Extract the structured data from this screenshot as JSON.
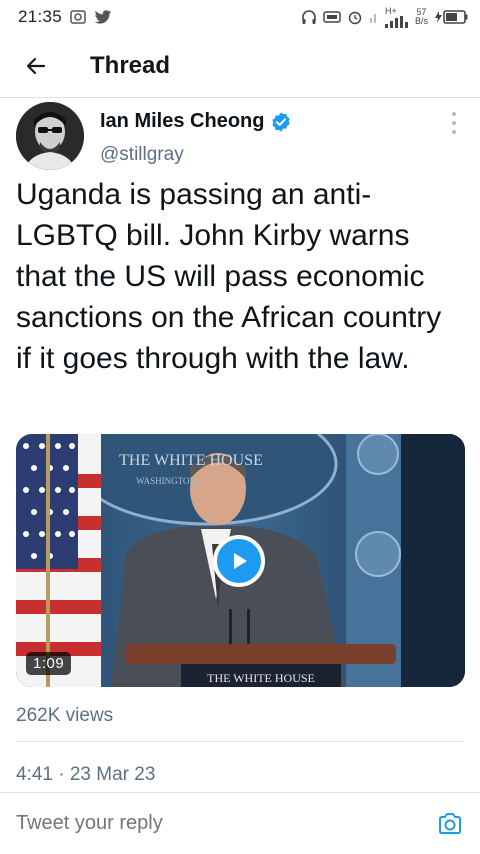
{
  "status_bar": {
    "time": "21:35",
    "network_type": "H+",
    "speed_value": "57",
    "speed_unit": "B/s"
  },
  "header": {
    "title": "Thread"
  },
  "tweet": {
    "author": {
      "display_name": "Ian Miles Cheong",
      "handle": "@stillgray",
      "verified": true
    },
    "text": "Uganda is passing an anti-LGBTQ bill. John Kirby warns that the US will pass economic sanctions on the African country if it goes through with the law.",
    "media": {
      "duration": "1:09",
      "backdrop_text": "THE WHITE HOUSE",
      "backdrop_subtext": "WASHINGTON",
      "podium_text": "THE WHITE HOUSE"
    },
    "views": "262K views",
    "timestamp": "4:41 · 23 Mar 23"
  },
  "reply": {
    "placeholder": "Tweet your reply"
  },
  "colors": {
    "accent": "#1d9bf0",
    "secondary_text": "#5b7083",
    "divider": "#dfe3e6"
  },
  "icons": {
    "back": "arrow-left-icon",
    "verified": "verified-badge-icon",
    "more": "more-vertical-icon",
    "play": "play-icon",
    "camera": "camera-icon"
  }
}
